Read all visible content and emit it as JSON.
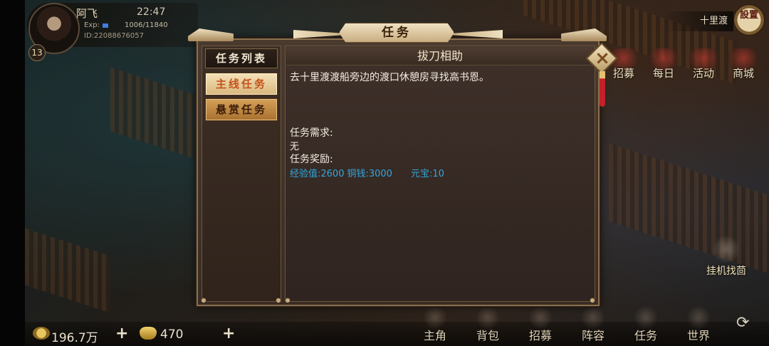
{
  "player": {
    "name": "阿飞",
    "time": "22:47",
    "exp_label": "Exp:",
    "exp_text": "1006/11840",
    "exp_fraction": 0.085,
    "id": "ID:22088676057",
    "level": "13"
  },
  "location": "十里渡",
  "settings_label": "設置",
  "side_buttons": [
    "招募",
    "每日",
    "活动",
    "商城"
  ],
  "afk_label": "挂机找茴",
  "currency": {
    "copper": "196.7万",
    "gold": "470"
  },
  "nav": [
    "主角",
    "背包",
    "招募",
    "阵容",
    "任务",
    "世界"
  ],
  "dialog": {
    "title": "任务",
    "sidebar_header": "任务列表",
    "tabs": [
      "主线任务",
      "悬赏任务"
    ],
    "task_title": "拔刀相助",
    "task_desc": "去十里渡渡船旁边的渡口休憩房寻找高书恩。",
    "requirement_label": "任务需求:",
    "requirement_value": "无",
    "reward_label": "任务奖励:",
    "rewards": {
      "exp": "经验值:2600",
      "copper": "铜钱:3000",
      "ingot": "元宝:10"
    },
    "close": "×"
  },
  "colors": {
    "reward_text": "#2fa8e0",
    "active_tab_text": "#c4521c",
    "dialog_border": "#8a7150"
  }
}
